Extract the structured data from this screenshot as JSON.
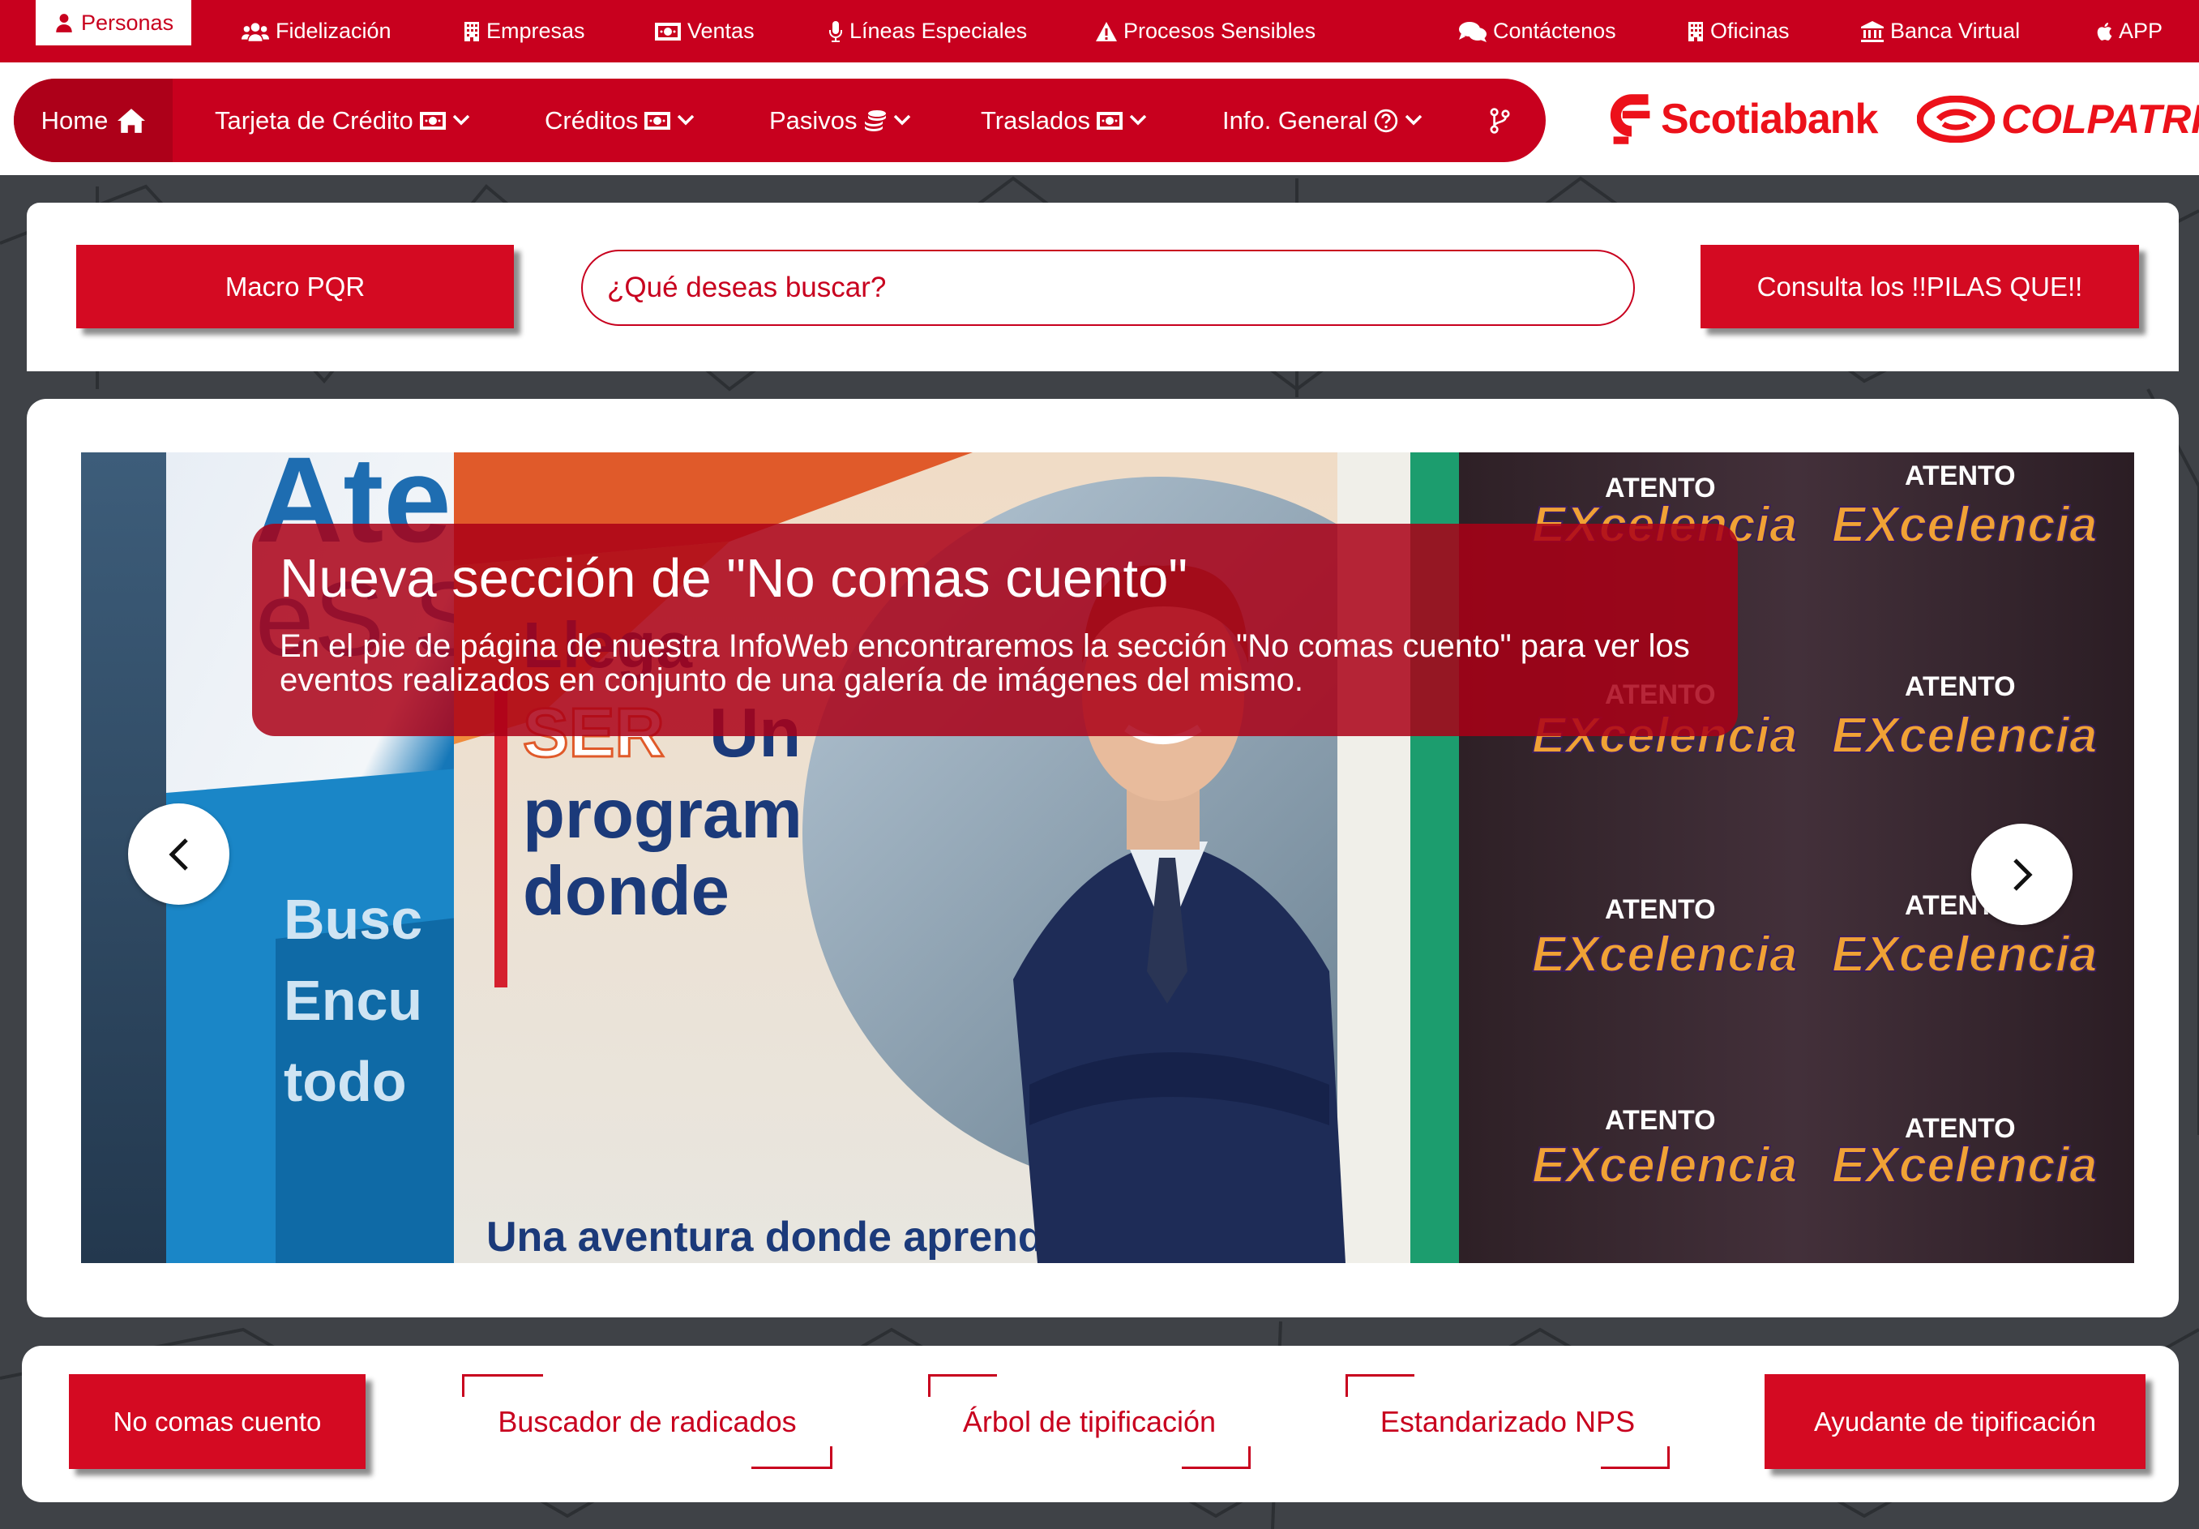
{
  "topbar": {
    "items": [
      {
        "label": "Personas",
        "icon": "user-icon"
      },
      {
        "label": "Fidelización",
        "icon": "users-icon"
      },
      {
        "label": "Empresas",
        "icon": "building-icon"
      },
      {
        "label": "Ventas",
        "icon": "money-icon"
      },
      {
        "label": "Líneas Especiales",
        "icon": "microphone-icon"
      },
      {
        "label": "Procesos Sensibles",
        "icon": "warning-icon"
      },
      {
        "label": "Contáctenos",
        "icon": "chat-icon"
      },
      {
        "label": "Oficinas",
        "icon": "building-icon"
      },
      {
        "label": "Banca Virtual",
        "icon": "bank-icon"
      },
      {
        "label": "APP",
        "icon": "apple-icon"
      }
    ]
  },
  "nav": {
    "home": "Home",
    "items": [
      {
        "label": "Tarjeta de Crédito",
        "icon": "money-icon"
      },
      {
        "label": "Créditos",
        "icon": "money-icon"
      },
      {
        "label": "Pasivos",
        "icon": "coins-icon"
      },
      {
        "label": "Traslados",
        "icon": "money-icon"
      },
      {
        "label": "Info. General",
        "icon": "question-circle-icon"
      }
    ]
  },
  "brand": {
    "scotiabank": "Scotiabank",
    "colpatria": "COLPATRIA",
    "color": "#ec111a"
  },
  "search": {
    "macro_label": "Macro PQR",
    "placeholder": "¿Qué deseas buscar?",
    "pilas_label": "Consulta los !!PILAS QUE!!"
  },
  "carousel": {
    "title": "Nueva sección de \"No comas cuento\"",
    "text": "En el pie de página de nuestra InfoWeb encontraremos la sección \"No comas cuento\" para ver los eventos realizados en conjunto de una galería de imágenes del mismo."
  },
  "bottom": {
    "no_comas": "No comas cuento",
    "buscador": "Buscador de radicados",
    "arbol": "Árbol de tipificación",
    "nps": "Estandarizado NPS",
    "ayudante": "Ayudante de tipificación"
  },
  "colors": {
    "primary_red": "#c8001e",
    "button_red": "#d40a22",
    "background": "#3f4247"
  }
}
